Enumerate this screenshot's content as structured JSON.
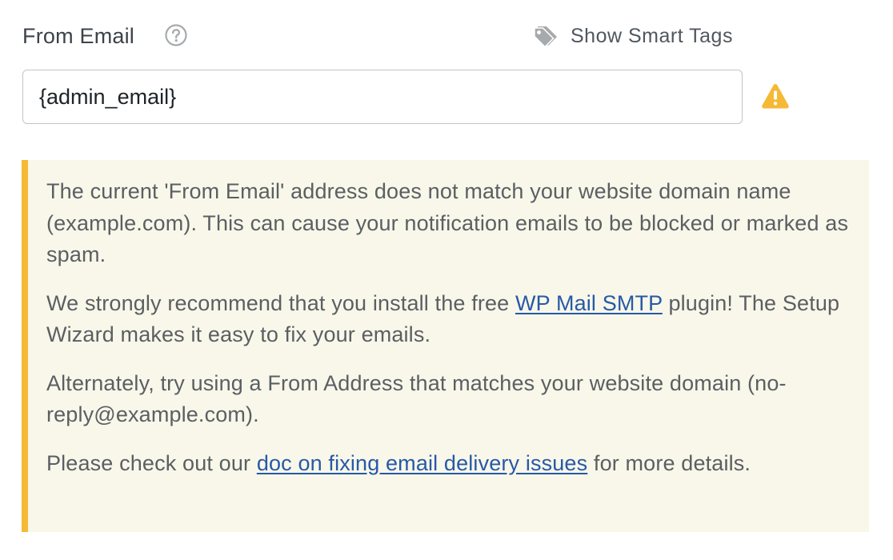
{
  "field": {
    "label": "From Email",
    "help_icon": "question-circle-icon",
    "smart_tags_label": "Show Smart Tags",
    "smart_tags_icon": "tag-icon",
    "input_value": "{admin_email}",
    "warning_icon": "warning-triangle-icon"
  },
  "notice": {
    "p1": "The current 'From Email' address does not match your website domain name (example.com). This can cause your notification emails to be blocked or marked as spam.",
    "p2_before": "We strongly recommend that you install the free ",
    "p2_link": "WP Mail SMTP",
    "p2_after": " plugin! The Setup Wizard makes it easy to fix your emails.",
    "p3": "Alternately, try using a From Address that matches your website domain (no-reply@example.com).",
    "p4_before": "Please check out our ",
    "p4_link": "doc on fixing email delivery issues",
    "p4_after": " for more details."
  },
  "colors": {
    "notice_background": "#f8f7e9",
    "notice_border": "#f6b935",
    "link": "#2759a7",
    "warning": "#f6b935"
  }
}
